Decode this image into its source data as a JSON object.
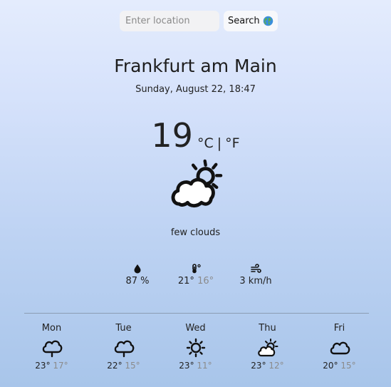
{
  "search": {
    "placeholder": "Enter location",
    "value": "",
    "button_label": "Search",
    "button_icon": "globe-icon"
  },
  "location": {
    "city": "Frankfurt am Main",
    "datetime": "Sunday, August 22, 18:47"
  },
  "current": {
    "temperature": "19",
    "unit_celsius": "°C",
    "unit_separator": "|",
    "unit_fahrenheit": "°F",
    "icon": "sun-behind-cloud-icon",
    "description": "few clouds"
  },
  "stats": {
    "humidity": {
      "icon": "droplet-icon",
      "value": "87 %"
    },
    "temperature_range": {
      "icon": "thermometer-icon",
      "max": "21°",
      "min": "16°"
    },
    "wind": {
      "icon": "wind-icon",
      "value": "3 km/h"
    }
  },
  "forecast": [
    {
      "day": "Mon",
      "icon": "rain-cloud-icon",
      "max": "23°",
      "min": "17°"
    },
    {
      "day": "Tue",
      "icon": "rain-cloud-icon",
      "max": "22°",
      "min": "15°"
    },
    {
      "day": "Wed",
      "icon": "sun-icon",
      "max": "23°",
      "min": "11°"
    },
    {
      "day": "Thu",
      "icon": "sun-behind-cloud-icon",
      "max": "23°",
      "min": "12°"
    },
    {
      "day": "Fri",
      "icon": "cloud-icon",
      "max": "20°",
      "min": "15°"
    }
  ],
  "colors": {
    "text": "#222222",
    "muted": "#8b8b8b",
    "background_top": "#e4ecfd",
    "background_bottom": "#a8c5ea"
  }
}
